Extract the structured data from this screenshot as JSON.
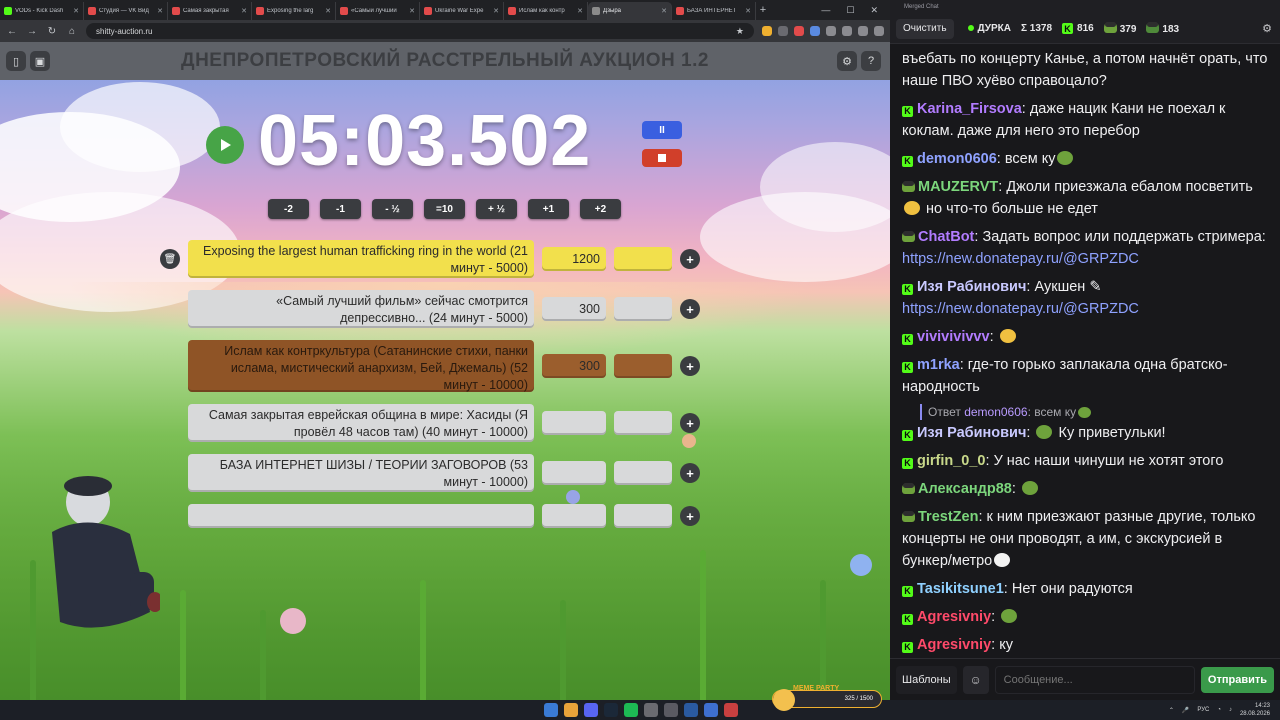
{
  "browser": {
    "tabs": [
      {
        "label": "VODs - Kick Dash",
        "color": "#53fc18"
      },
      {
        "label": "Студия — VK Вид",
        "color": "#e24b4b"
      },
      {
        "label": "Самая закрытая",
        "color": "#e24b4b"
      },
      {
        "label": "Exposing the larg",
        "color": "#e24b4b"
      },
      {
        "label": "«Самый лучший",
        "color": "#e24b4b"
      },
      {
        "label": "Ukraine War Expe",
        "color": "#e24b4b"
      },
      {
        "label": "Ислам как контр",
        "color": "#e24b4b"
      },
      {
        "label": "Дзыра",
        "color": "#8b8b8b",
        "active": true
      },
      {
        "label": "БАЗА ИНТЕРНЕТ",
        "color": "#e24b4b"
      }
    ],
    "url": "shitty-auction.ru"
  },
  "auction": {
    "title": "ДНЕПРОПЕТРОВСКИЙ РАССТРЕЛЬНЫЙ АУКЦИОН 1.2",
    "timer": "05:03.502",
    "pause_label": "II",
    "steps": [
      "-2",
      "-1",
      "- ½",
      "=10",
      "+ ½",
      "+1",
      "+2"
    ],
    "lots": [
      {
        "text": "Exposing the largest human trafficking ring in the world (21 минут - 5000)",
        "amount": "1200",
        "style": "yellow"
      },
      {
        "text": "«Самый лучший фильм» сейчас смотрится депрессивно... (24 минут - 5000)",
        "amount": "300",
        "style": "grey"
      },
      {
        "text": "Ислам как контркультура (Сатанинские стихи, панки ислама, мистический анархизм,  Бей, Джемаль) (52 минут - 10000)",
        "amount": "300",
        "style": "brown"
      },
      {
        "text": "Самая закрытая еврейская община в мире: Хасиды (Я провёл 48 часов там) (40 минут - 10000)",
        "amount": "",
        "style": "grey"
      },
      {
        "text": "БАЗА ИНТЕРНЕТ ШИЗЫ / ТЕОРИИ ЗАГОВОРОВ (53 минут - 10000)",
        "amount": "",
        "style": "grey"
      },
      {
        "text": "",
        "amount": "",
        "style": "grey"
      }
    ]
  },
  "chat": {
    "window_title": "Merged Chat",
    "clear_label": "Очистить",
    "streamer": "ДУРКА",
    "stats": {
      "total": "Σ 1378",
      "kick": "816",
      "twitch": "379",
      "other": "183"
    },
    "messages": [
      {
        "user": "",
        "text": "въебать по концерту Канье, а потом начнёт орать, что наше ПВО хуёво справоцало?",
        "color": "#efeff1",
        "badge": ""
      },
      {
        "user": "Karina_Firsova",
        "text": "даже нацик Кани не поехал к коклам. даже для него это перебор",
        "color": "#b27cff",
        "badge": "kick"
      },
      {
        "user": "demon0606",
        "text": "всем ку",
        "color": "#8fa2ff",
        "badge": "kick",
        "emote": "pepe"
      },
      {
        "user": "MAUZERVT",
        "text": "Джоли приезжала ебалом посветить",
        "text2": "но что-то больше не едет",
        "color": "#7cd67c",
        "badge": "pepe",
        "emote2": "sad"
      },
      {
        "user": "ChatBot",
        "text": "Задать вопрос или поддержать стримера: ",
        "link": "https://new.donatepay.ru/@GRPZDC",
        "color": "#b27cff",
        "badge": "pepe"
      },
      {
        "user": "Изя Рабинович",
        "text": "Аукшен",
        "link": "https://new.donatepay.ru/@GRPZDC",
        "color": "#c9c9ff",
        "badge": "kick"
      },
      {
        "user": "vivivivivvv",
        "text": "",
        "color": "#b27cff",
        "badge": "kick",
        "emote": "yellow"
      },
      {
        "user": "m1rka",
        "text": "где-то горько заплакала одна братско-народность",
        "color": "#8fa2ff",
        "badge": "kick"
      },
      {
        "reply": "Ответ",
        "reply_user": "demon0606",
        "reply_text": "всем ку"
      },
      {
        "user": "Изя Рабинович",
        "text": "Ку приветульки!",
        "color": "#c9c9ff",
        "badge": "kick",
        "emote_before": "pepe"
      },
      {
        "user": "girfin_0_0",
        "text": "У нас наши чинуши не хотят этого",
        "color": "#c8d88a",
        "badge": "kick"
      },
      {
        "user": "Александр88",
        "text": "",
        "color": "#7cd67c",
        "badge": "pepe",
        "emote": "pepe"
      },
      {
        "user": "TrestZen",
        "text": "к ним приезжают разные другие, только концерты не они проводят, а им, с экскурсией в бункер/метро",
        "color": "#7cd67c",
        "badge": "pepe",
        "emote": "white"
      },
      {
        "user": "Tasikitsune1",
        "text": "Нет они радуются",
        "color": "#8fd0ff",
        "badge": "kick"
      },
      {
        "user": "Agresivniy",
        "text": "",
        "color": "#ff4a6a",
        "badge": "kick",
        "emote": "pepe"
      },
      {
        "user": "Agresivniy",
        "text": "ку",
        "color": "#ff4a6a",
        "badge": "kick"
      }
    ],
    "templates_label": "Шаблоны",
    "input_placeholder": "Сообщение...",
    "send_label": "Отправить"
  },
  "overlay": {
    "meme_party": "MEME PARTY",
    "meme_progress": "325 / 1500"
  },
  "taskbar": {
    "lang": "РУС",
    "time": "14:23",
    "date": "28.08.2026"
  }
}
